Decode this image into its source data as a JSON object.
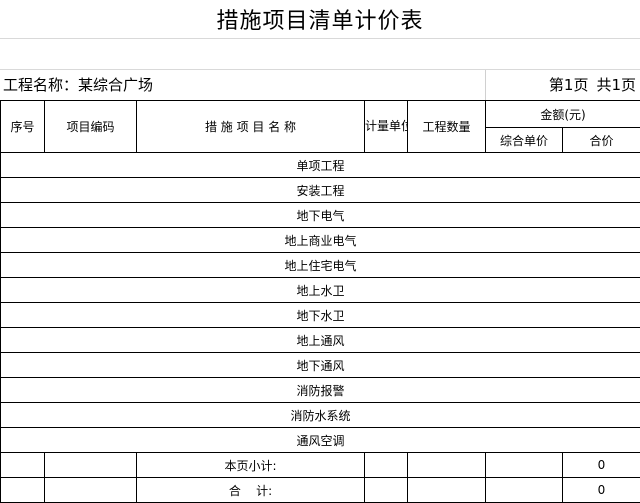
{
  "title": "措施项目清单计价表",
  "project_label": "工程名称：",
  "project_name": "某综合广场",
  "page_current": "第1页",
  "page_total": "共1页",
  "headers": {
    "seq": "序号",
    "code": "项目编码",
    "name": "措 施 项 目 名 称",
    "unit": "计量单位",
    "quantity": "工程数量",
    "amount": "金额(元)",
    "unit_price": "综合单价",
    "total_price": "合价"
  },
  "sections": [
    "单项工程",
    "安装工程",
    "地下电气",
    "地上商业电气",
    "地上住宅电气",
    "地上水卫",
    "地下水卫",
    "地上通风",
    "地下通风",
    "消防报警",
    "消防水系统",
    "通风空调"
  ],
  "summary": {
    "subtotal_label": "本页小计:",
    "subtotal_value": "0",
    "total_label": "合    计:",
    "total_value": "0"
  }
}
